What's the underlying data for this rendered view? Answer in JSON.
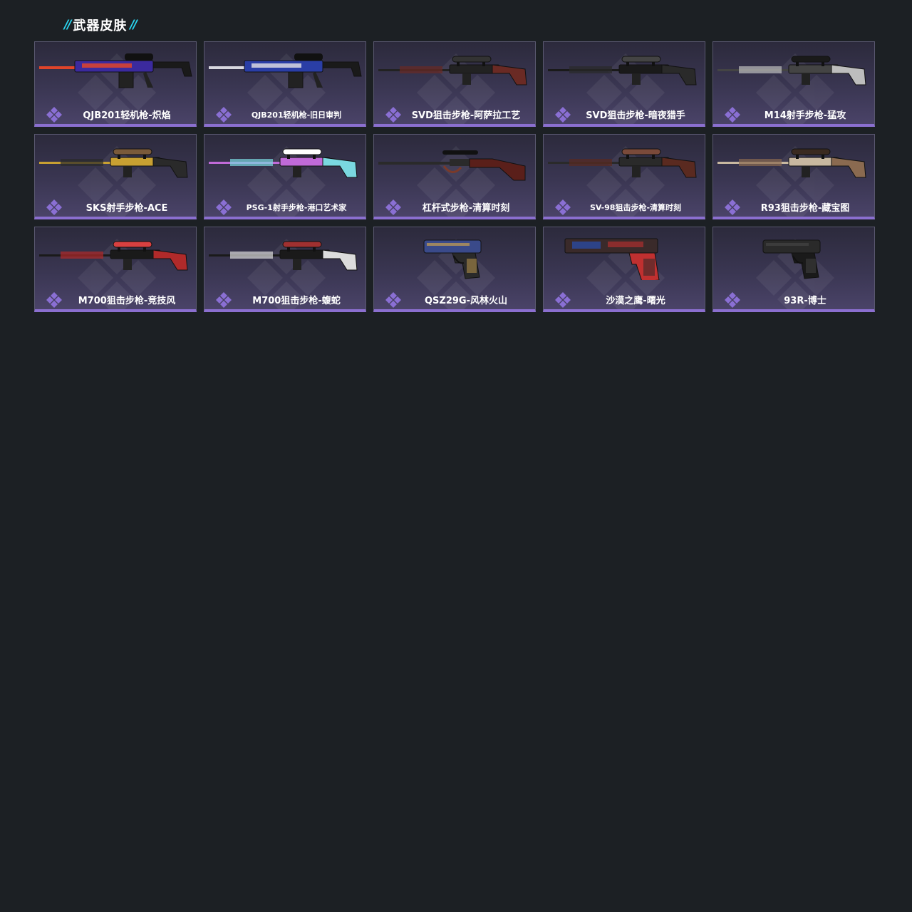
{
  "section": {
    "title": "武器皮肤"
  },
  "colors": {
    "accent": "#2ad7f2",
    "card_border_bottom": "#8b6fd0",
    "badge": "#8a6fd4"
  },
  "skins": [
    {
      "name": "QJB201轻机枪-炽焰",
      "icon": "machine-gun-icon",
      "palette": [
        "#e0442a",
        "#3b2a9e",
        "#1a1a1a"
      ]
    },
    {
      "name": "QJB201轻机枪-旧日审判",
      "icon": "machine-gun-icon",
      "palette": [
        "#d8d8e0",
        "#2a3ea6",
        "#1a1a1a"
      ]
    },
    {
      "name": "SVD狙击步枪-阿萨拉工艺",
      "icon": "sniper-rifle-icon",
      "palette": [
        "#6a2a24",
        "#222222",
        "#333333"
      ]
    },
    {
      "name": "SVD狙击步枪-暗夜猎手",
      "icon": "sniper-rifle-icon",
      "palette": [
        "#2a2a2a",
        "#1a1a1a",
        "#444444"
      ]
    },
    {
      "name": "M14射手步枪-猛攻",
      "icon": "marksman-rifle-icon",
      "palette": [
        "#bdbdbd",
        "#444444",
        "#1a1a1a"
      ]
    },
    {
      "name": "SKS射手步枪-ACE",
      "icon": "marksman-rifle-icon",
      "palette": [
        "#2a2a2a",
        "#c8a032",
        "#7a5a3a"
      ]
    },
    {
      "name": "PSG-1射手步枪-港口艺术家",
      "icon": "marksman-rifle-icon",
      "palette": [
        "#7ad8e0",
        "#c06ad8",
        "#ffffff"
      ]
    },
    {
      "name": "杠杆式步枪-清算时刻",
      "icon": "lever-rifle-icon",
      "palette": [
        "#5a1f1a",
        "#2a2a2a",
        "#7a3a2a"
      ]
    },
    {
      "name": "SV-98狙击步枪-清算时刻",
      "icon": "sniper-rifle-icon",
      "palette": [
        "#5a2a20",
        "#2a2a2a",
        "#7a4a3a"
      ]
    },
    {
      "name": "R93狙击步枪-藏宝图",
      "icon": "sniper-rifle-icon",
      "palette": [
        "#8a6a50",
        "#c8b8a0",
        "#3a2a20"
      ]
    },
    {
      "name": "M700狙击步枪-竞技风",
      "icon": "sniper-rifle-icon",
      "palette": [
        "#b02a2a",
        "#1a1a1a",
        "#d84040"
      ]
    },
    {
      "name": "M700狙击步枪-蝮蛇",
      "icon": "sniper-rifle-icon",
      "palette": [
        "#dcdcdc",
        "#1a1a1a",
        "#a03030"
      ]
    },
    {
      "name": "QSZ29G-风林火山",
      "icon": "pistol-icon",
      "palette": [
        "#3a4a8a",
        "#2a2a2a",
        "#c8a050"
      ]
    },
    {
      "name": "沙漠之鹰-曙光",
      "icon": "desert-eagle-icon",
      "palette": [
        "#3a2a2a",
        "#c03030",
        "#2a4aa0"
      ]
    },
    {
      "name": "93R-博士",
      "icon": "pistol-icon",
      "palette": [
        "#2a2a2a",
        "#1a1a1a",
        "#444444"
      ]
    }
  ]
}
